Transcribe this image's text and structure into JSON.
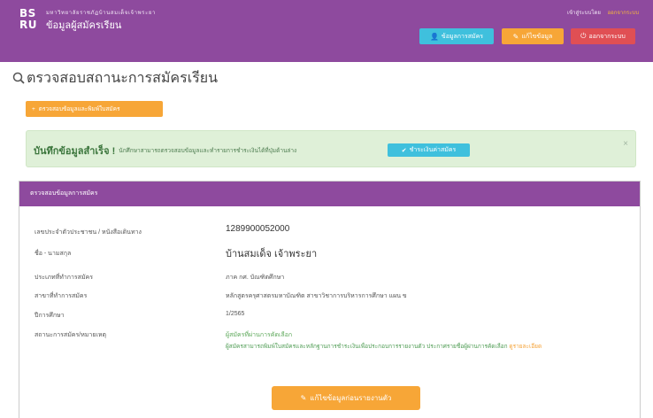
{
  "header": {
    "logo_text": "BS\nRU",
    "logo_sub": "มหาวิทยาลัยราชภัฏบ้านสมเด็จเจ้าพระยา",
    "logo_title": "ข้อมูลผู้สมัครเรียน",
    "top_right_text": "เข้าสู่ระบบโดย",
    "top_right_accent": "ออกจากระบบ",
    "buttons": [
      {
        "label": "ข้อมูลการสมัคร",
        "color": "#3fc0dd",
        "icon": "user-icon"
      },
      {
        "label": "แก้ไขข้อมูล",
        "color": "#f7a637",
        "icon": "pencil-icon"
      },
      {
        "label": "ออกจากระบบ",
        "color": "#e04f54",
        "icon": "power-icon"
      }
    ]
  },
  "page": {
    "title": "ตรวจสอบสถานะการสมัครเรียน",
    "status_button": "ตรวจสอบข้อมูลและพิมพ์ใบสมัคร"
  },
  "alert": {
    "title": "บันทึกข้อมูลสำเร็จ !",
    "message": "นักศึกษาสามารถตรวจสอบข้อมูลและทำรายการชำระเงินได้ที่ปุ่มด้านล่าง",
    "button": "ชำระเงินค่าสมัคร",
    "close": "×"
  },
  "panel": {
    "title": "ตรวจสอบข้อมูลการสมัคร",
    "rows": [
      {
        "label": "เลขประจำตัวประชาชน / หนังสือเดินทาง",
        "value": "1289900052000"
      },
      {
        "label": "ชื่อ - นามสกุล",
        "value": "บ้านสมเด็จ เจ้าพระยา"
      },
      {
        "label": "ประเภทที่ทำการสมัคร",
        "value": "ภาค กศ. บัณฑิตศึกษา"
      },
      {
        "label": "สาขาที่ทำการสมัคร",
        "value": "หลักสูตรครุศาสตรมหาบัณฑิต สาขาวิชาการบริหารการศึกษา แผน ข"
      },
      {
        "label": "ปีการศึกษา",
        "value": "1/2565"
      },
      {
        "label": "สถานะการสมัคร/หมายเหตุ",
        "value": "ผู้สมัครที่ผ่านการคัดเลือก",
        "note": "ผู้สมัครสามารถพิมพ์ใบสมัครและหลักฐานการชำระเงินเพื่อประกอบการรายงานตัว ประกาศรายชื่อผู้ผ่านการคัดเลือก",
        "note_link": "ดูรายละเอียด"
      }
    ],
    "footer_button": "แก้ไขข้อมูลก่อนรายงานตัว"
  },
  "colors": {
    "primary": "#8e4a9e",
    "info": "#3fc0dd",
    "warning": "#f7a637",
    "danger": "#e04f54",
    "success_bg": "#dff0d8"
  }
}
